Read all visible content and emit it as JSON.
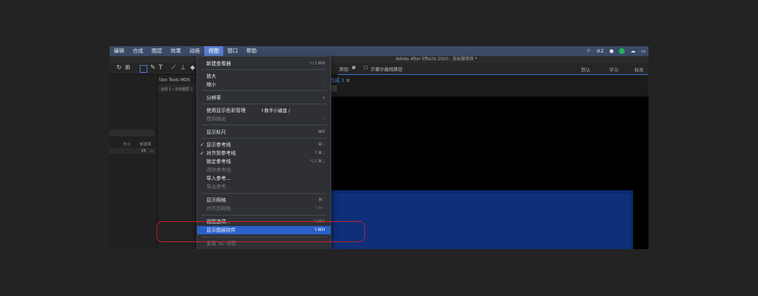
{
  "menubar": {
    "items": [
      "编辑",
      "合成",
      "图层",
      "效果",
      "动画",
      "视图",
      "窗口",
      "帮助"
    ],
    "active_index": 5,
    "tray": {
      "calendar": "2"
    }
  },
  "titlebar": {
    "title": "Adobe After Effects 2020 - 无标题项目 *"
  },
  "toolbar": {
    "add_label": "添加:",
    "bezier_label": "贝塞尔曲线路径",
    "workspaces": [
      "默认",
      "学习",
      "标准"
    ]
  },
  "left_panel": {
    "col_size": "大小",
    "col_frame": "帧速率",
    "frame_value": "25"
  },
  "mid_panel": {
    "title": "tion Tools MDS",
    "breadcrumb": "合成 1 • 形状图层 1"
  },
  "comp_panel": {
    "tab": "合成 1",
    "menu_glyph": "≡"
  },
  "view_menu": {
    "new_viewer": {
      "label": "新建查看器",
      "shortcut": "⌥⇧⌘N"
    },
    "zoom_in": {
      "label": "放大",
      "shortcut": "."
    },
    "zoom_out": {
      "label": "缩小",
      "shortcut": ","
    },
    "resolution": {
      "label": "分辨率"
    },
    "color_mgmt": {
      "label": "使用显示色彩管理",
      "shortcut": "⇧数字小键盘 /"
    },
    "simulate_output": {
      "label": "模拟输出"
    },
    "show_rulers": {
      "label": "显示标尺",
      "shortcut": "⌘R"
    },
    "show_guides": {
      "label": "显示参考线",
      "shortcut": "⌘ ;"
    },
    "snap_guides": {
      "label": "对齐到参考线",
      "shortcut": "⇧⌘ ;"
    },
    "lock_guides": {
      "label": "锁定参考线",
      "shortcut": "⌥⇧⌘ ;"
    },
    "clear_guides": {
      "label": "清除参考线"
    },
    "import_guides": {
      "label": "导入参考..."
    },
    "export_guides": {
      "label": "导出参考..."
    },
    "show_grid": {
      "label": "显示网格",
      "shortcut": "⌘ '"
    },
    "snap_grid": {
      "label": "对齐到网格",
      "shortcut": "⇧⌘ '"
    },
    "view_options": {
      "label": "视图选项...",
      "shortcut": "⌥⌘U"
    },
    "show_layer_controls": {
      "label": "显示图层控件",
      "shortcut": "⇧⌘H"
    },
    "reset_3d": {
      "label": "重置 3D 视图"
    }
  },
  "colors": {
    "highlight": "#2a60c9",
    "annotation": "#d0202a",
    "layer": "#0e2f7a"
  }
}
